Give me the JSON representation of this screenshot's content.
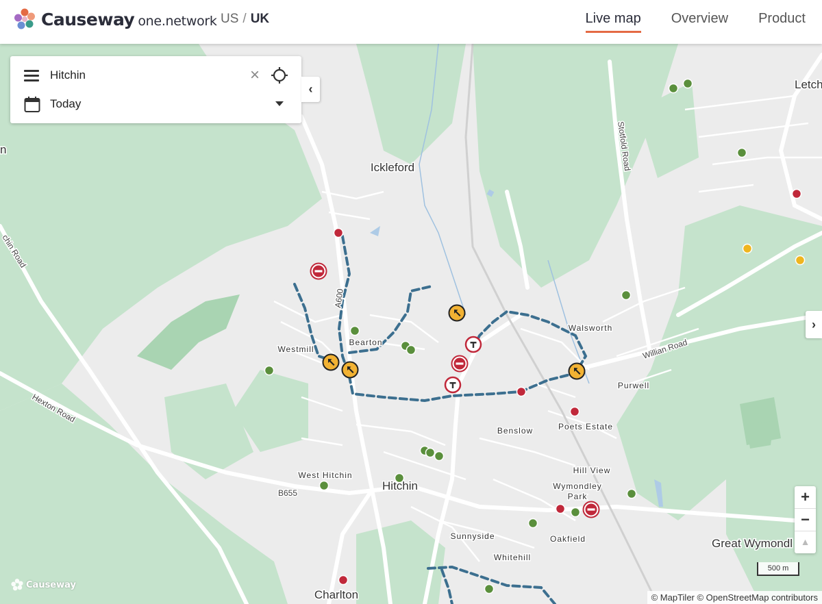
{
  "header": {
    "brand_name": "Causeway",
    "brand_sub": "one.network",
    "region_us": "US",
    "region_sep": "/",
    "region_uk": "UK",
    "nav": [
      {
        "label": "Live map",
        "active": true
      },
      {
        "label": "Overview",
        "active": false
      },
      {
        "label": "Product",
        "active": false
      }
    ]
  },
  "search": {
    "location": "Hitchin",
    "date": "Today",
    "menu_icon": "hamburger-menu-icon",
    "clear_icon": "close-icon",
    "locate_icon": "crosshair-locate-icon",
    "calendar_icon": "calendar-icon",
    "dropdown_icon": "caret-down-icon"
  },
  "controls": {
    "collapse": "‹",
    "expand": "›",
    "zoom_in": "+",
    "zoom_out": "−",
    "compass": "▲"
  },
  "map": {
    "places": [
      "Letchworth",
      "Ickleford",
      "Walsworth",
      "Westmill",
      "Bearton",
      "Purwell",
      "Poets Estate",
      "Benslow",
      "Hill View",
      "Wymondley",
      "Park",
      "West Hitchin",
      "Hitchin",
      "Sunnyside",
      "Oakfield",
      "Whitehill",
      "Great Wymondl",
      "Charlton"
    ],
    "roads": [
      "Stotfold Road",
      "Willian Road",
      "Hexton Road",
      "chin Road",
      "A600",
      "B655"
    ],
    "edge_label": "n",
    "scale": "500 m",
    "attribution": "© MapTiler © OpenStreetMap contributors",
    "watermark": "Causeway",
    "colors": {
      "land": "#ececec",
      "green": "#c5e3cc",
      "dark_green": "#a9d4b2",
      "road": "#ffffff",
      "water": "#aecbe6",
      "diversion": "#3c6f8f",
      "event_red": "#c0283a",
      "event_green": "#5a8f3c",
      "event_yellow": "#efb51f",
      "roadworks": "#f2b233",
      "closure": "#c0283a"
    }
  }
}
